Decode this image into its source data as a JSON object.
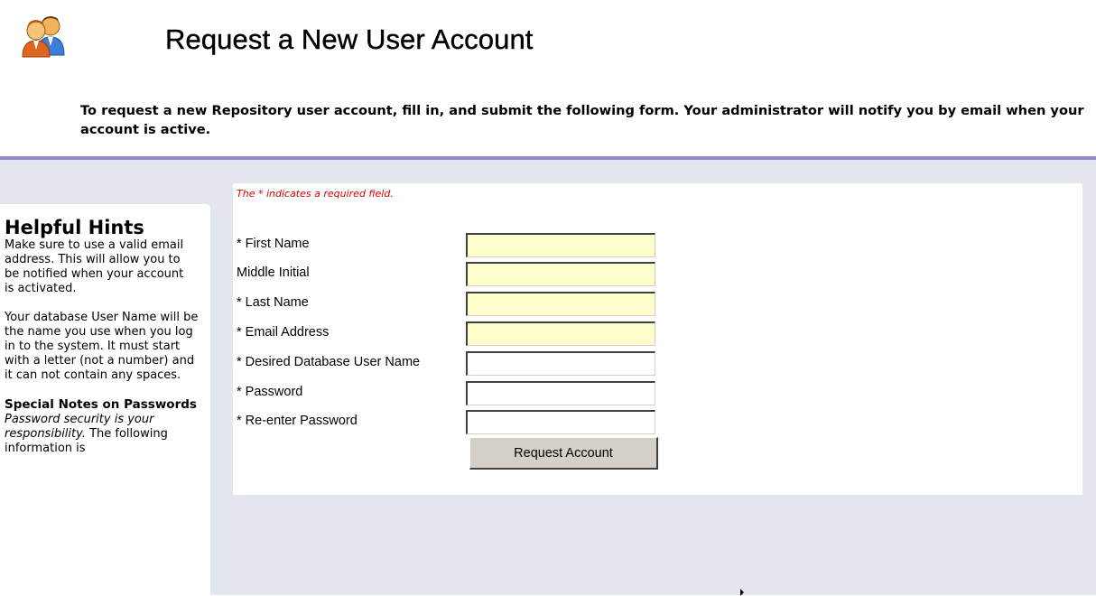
{
  "header": {
    "title": "Request a New User Account",
    "intro": "To request a new Repository user account, fill in, and submit the following form. Your administrator will notify you by email when your account is active."
  },
  "hints": {
    "heading": "Helpful Hints",
    "p1": "Make sure to use a valid email address. This will allow you to be notified when your account is activated.",
    "p2": "Your database User Name will be the name you use when you log in to the system. It must start with a letter (not a number) and it can not contain any spaces.",
    "p3_bold": "Special Notes on Passwords",
    "p3_italic": "Password security is your responsibility.",
    "p3_rest": "The following information is"
  },
  "form": {
    "required_note": "The * indicates a required field.",
    "fields": [
      {
        "label": "* First Name",
        "value": ""
      },
      {
        "label": "Middle Initial",
        "value": ""
      },
      {
        "label": "* Last Name",
        "value": ""
      },
      {
        "label": "* Email Address",
        "value": ""
      },
      {
        "label": "* Desired Database User Name",
        "value": ""
      },
      {
        "label": "* Password",
        "value": ""
      },
      {
        "label": "* Re-enter Password",
        "value": ""
      }
    ],
    "submit_label": "Request Account"
  },
  "colors": {
    "accent_rule": "#9987cc",
    "content_bg": "#e3e6ee",
    "highlight_input": "#ffffcc",
    "required_note": "#e00000"
  },
  "icons": {
    "header": "users-icon"
  }
}
